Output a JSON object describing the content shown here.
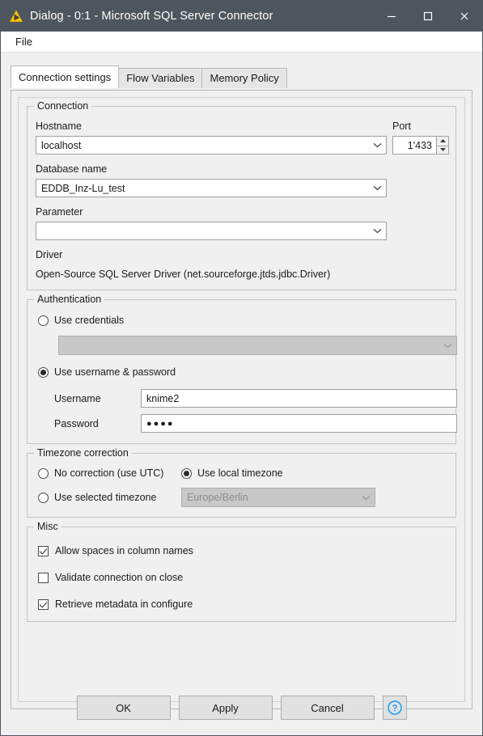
{
  "window": {
    "title": "Dialog - 0:1 - Microsoft SQL Server Connector",
    "icon": "knime-node-icon",
    "controls": {
      "minimize": "—",
      "maximize": "□",
      "close": "✕"
    }
  },
  "menubar": {
    "items": [
      {
        "label": "File"
      }
    ]
  },
  "tabs": [
    {
      "label": "Connection settings",
      "active": true
    },
    {
      "label": "Flow Variables",
      "active": false
    },
    {
      "label": "Memory Policy",
      "active": false
    }
  ],
  "connection": {
    "group_title": "Connection",
    "hostname_label": "Hostname",
    "hostname_value": "localhost",
    "port_label": "Port",
    "port_value": "1'433",
    "database_label": "Database name",
    "database_value": "EDDB_Inz-Lu_test",
    "parameter_label": "Parameter",
    "parameter_value": "",
    "driver_label": "Driver",
    "driver_value": "Open-Source SQL Server Driver (net.sourceforge.jtds.jdbc.Driver)"
  },
  "authentication": {
    "group_title": "Authentication",
    "use_credentials_label": "Use credentials",
    "use_credentials_selected": false,
    "credentials_value": "",
    "credentials_enabled": false,
    "use_userpass_label": "Use username & password",
    "use_userpass_selected": true,
    "username_label": "Username",
    "username_value": "knime2",
    "password_label": "Password",
    "password_value": "●●●●"
  },
  "timezone": {
    "group_title": "Timezone correction",
    "no_correction_label": "No correction (use UTC)",
    "no_correction_selected": false,
    "local_timezone_label": "Use local timezone",
    "local_timezone_selected": true,
    "selected_timezone_label": "Use selected timezone",
    "selected_timezone_selected": false,
    "timezone_value": "Europe/Berlin",
    "timezone_enabled": false
  },
  "misc": {
    "group_title": "Misc",
    "options": [
      {
        "label": "Allow spaces in column names",
        "checked": true
      },
      {
        "label": "Validate connection on close",
        "checked": false
      },
      {
        "label": "Retrieve metadata in configure",
        "checked": true
      }
    ]
  },
  "footer": {
    "ok_label": "OK",
    "apply_label": "Apply",
    "cancel_label": "Cancel",
    "help_icon": "help-circle-icon"
  },
  "colors": {
    "titlebar": "#4d555e",
    "panel": "#f0f0f0",
    "field_border": "#a0a0a0",
    "help_blue": "#2ea3f2",
    "icon_yellow": "#f2c100"
  }
}
